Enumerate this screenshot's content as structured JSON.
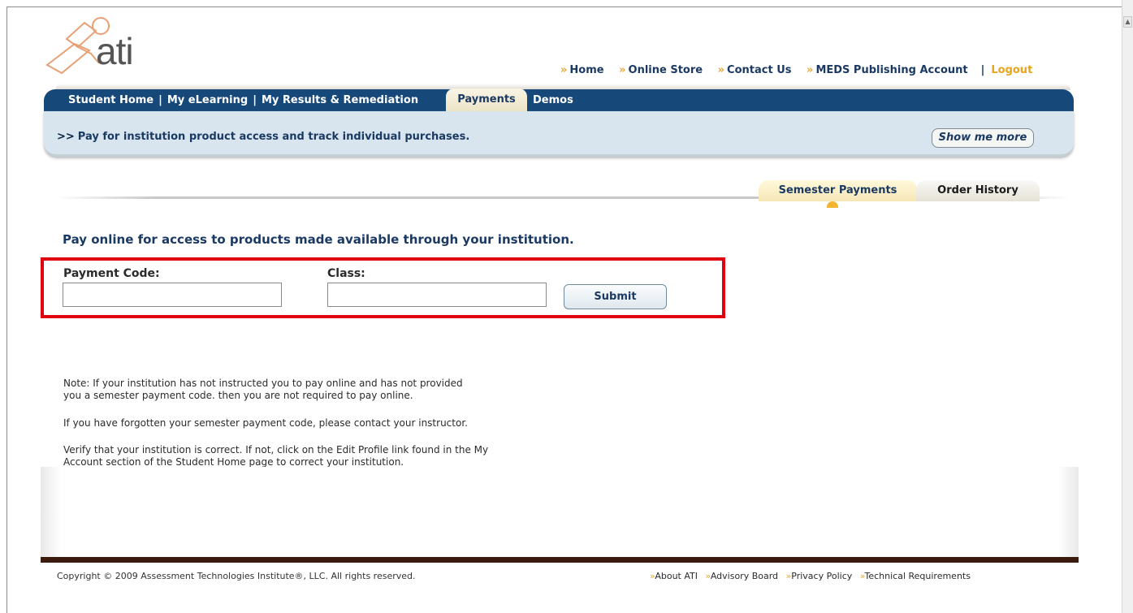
{
  "logo": {
    "text": "ati"
  },
  "top_links": [
    {
      "label": "Home"
    },
    {
      "label": "Online Store"
    },
    {
      "label": "Contact Us"
    },
    {
      "label": "MEDS Publishing Account"
    }
  ],
  "top_separator": "|",
  "logout_label": "Logout",
  "chevron": "»",
  "nav": {
    "items": [
      {
        "label": "Student Home"
      },
      {
        "label": "My eLearning"
      },
      {
        "label": "My Results & Remediation"
      }
    ],
    "separator": "|",
    "active_tab": "Payments",
    "demos": "Demos"
  },
  "info_bar": {
    "prefix": ">>",
    "text": "Pay for institution product access and track individual purchases.",
    "show_more": "Show me more"
  },
  "subtabs": {
    "semester": "Semester Payments",
    "order_history": "Order History"
  },
  "form": {
    "heading": "Pay online for access to products made available through your institution.",
    "payment_code_label": "Payment Code:",
    "payment_code_value": "",
    "class_label": "Class:",
    "class_value": "",
    "submit": "Submit"
  },
  "notes": {
    "note1_line1": "Note: If your institution has not instructed you to pay online and has not provided",
    "note1_line2": "you a semester payment code. then you are not required to pay online.",
    "note2": "If you have forgotten your semester payment code, please contact your instructor.",
    "note3_line1": "Verify that your institution is correct. If not, click on the Edit Profile link found in the My",
    "note3_line2": "Account section of the Student Home page to correct your institution."
  },
  "footer": {
    "copyright": "Copyright © 2009 Assessment Technologies Institute®, LLC. All rights reserved.",
    "links": [
      {
        "label": "About ATI"
      },
      {
        "label": "Advisory Board"
      },
      {
        "label": "Privacy Policy"
      },
      {
        "label": "Technical Requirements"
      }
    ]
  },
  "colors": {
    "nav_blue": "#16487a",
    "accent_orange": "#e8a41c",
    "highlight_red": "#e0000f",
    "info_bar_bg": "#d8e5ee",
    "footer_bar": "#3a1b0e"
  }
}
